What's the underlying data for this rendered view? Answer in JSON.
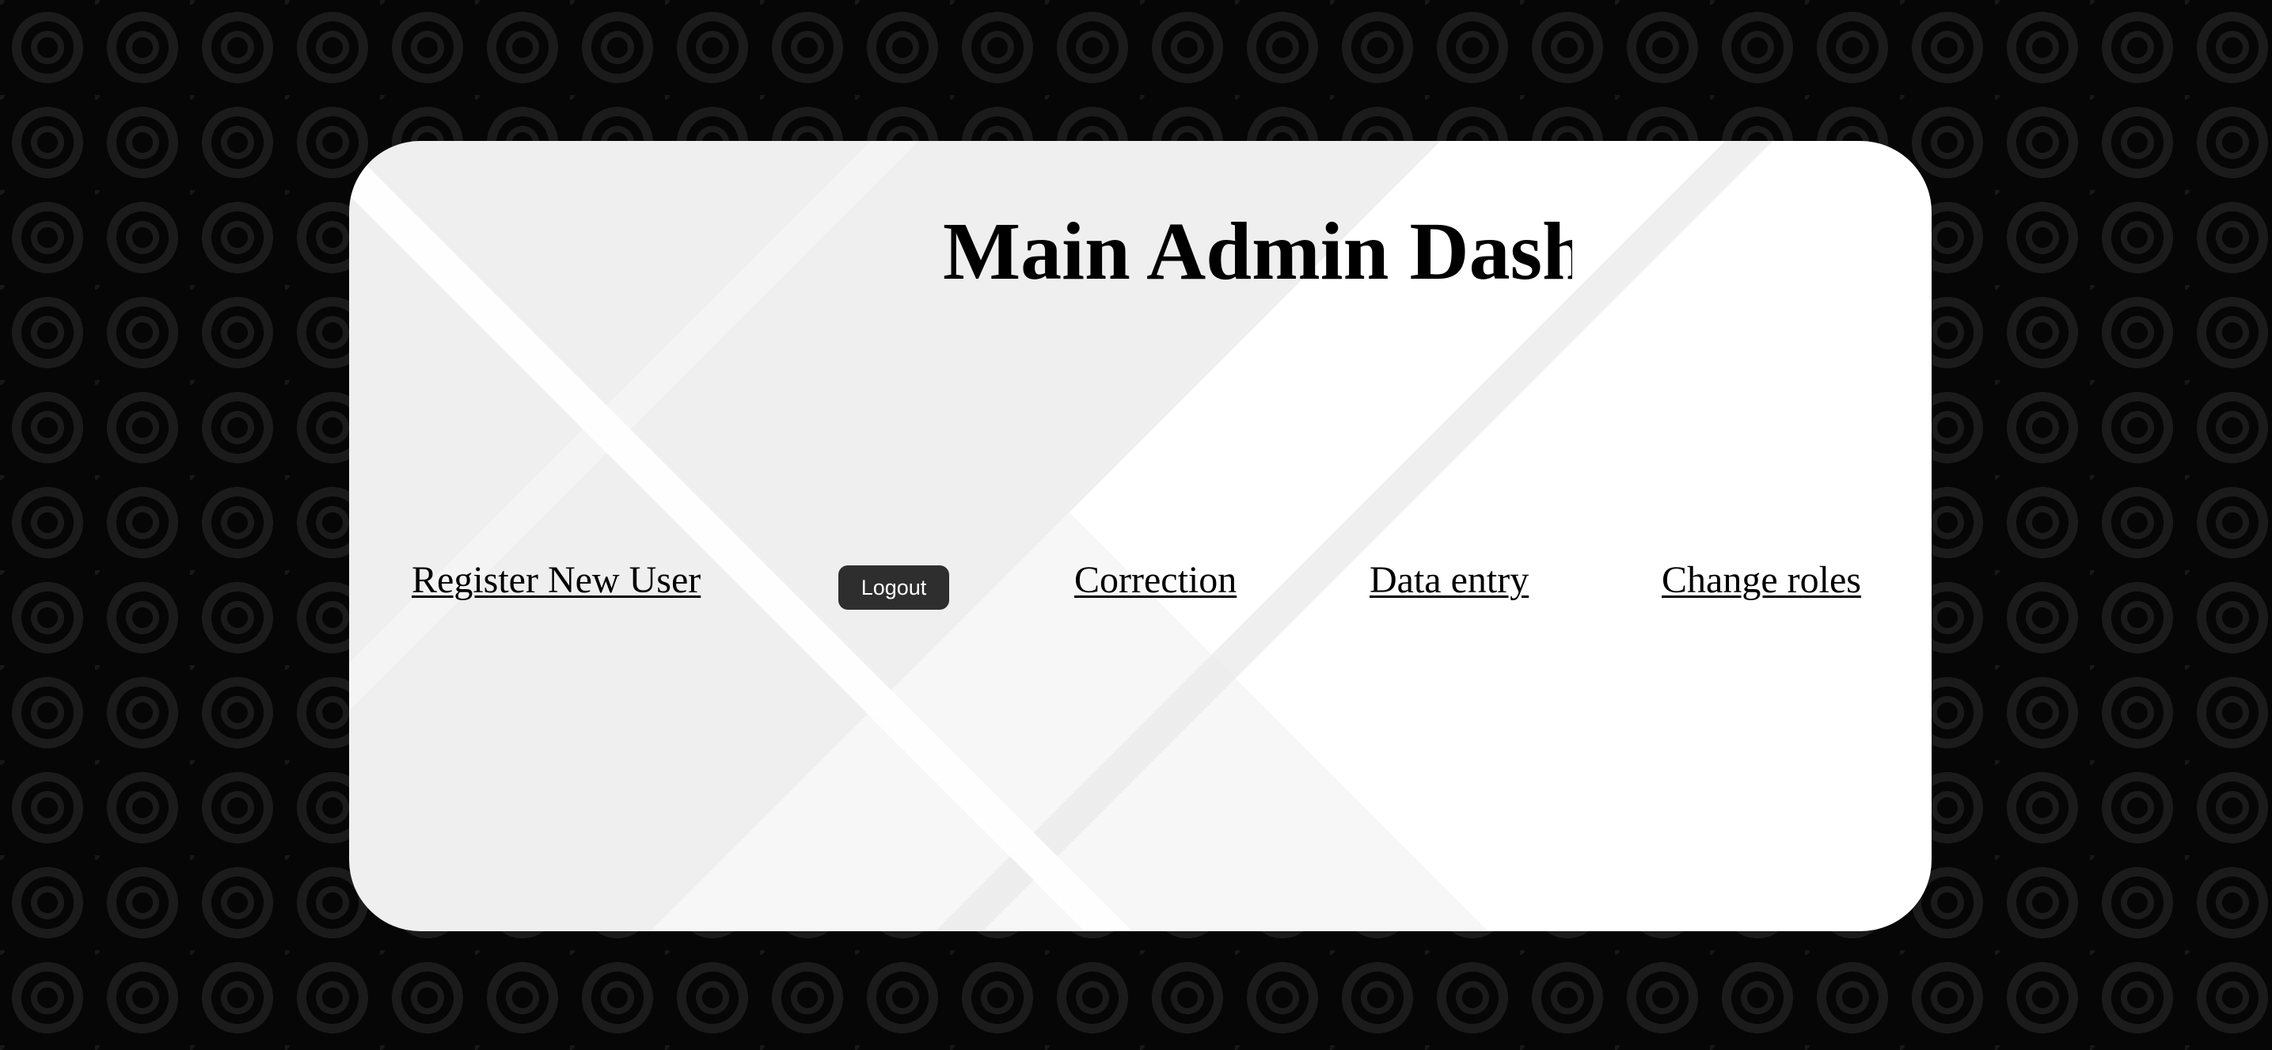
{
  "page": {
    "title": "Main Admin Dashboard"
  },
  "nav": {
    "register_label": "Register New User",
    "logout_label": "Logout",
    "correction_label": "Correction",
    "data_entry_label": "Data entry",
    "change_roles_label": "Change roles"
  },
  "colors": {
    "background": "#060606",
    "pattern": "#1b1b1b",
    "card": "#f7f7f7",
    "button": "#2e2e2e",
    "button_text": "#ffffff",
    "text": "#000000"
  }
}
